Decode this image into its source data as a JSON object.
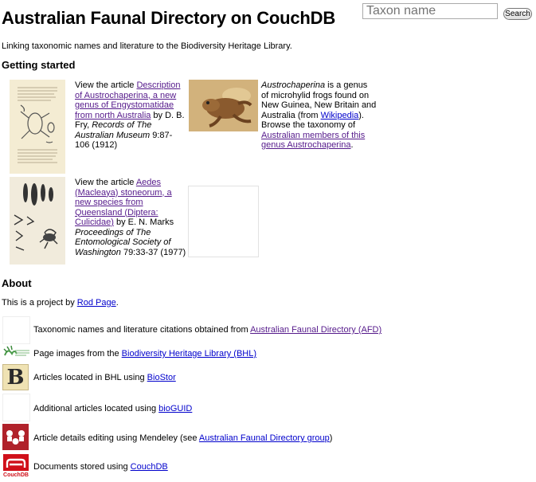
{
  "header": {
    "title": "Australian Faunal Directory on CouchDB",
    "search_placeholder": "Taxon name",
    "search_button": "Search",
    "subtitle": "Linking taxonomic names and literature to the Biodiversity Heritage Library."
  },
  "getting_started": {
    "heading": "Getting started",
    "article1": {
      "prefix": "View the article ",
      "link": "Description of Austrochaperina, a new genus of Engystomatidae from north Australia",
      "by": " by D. B. Fry, ",
      "journal": "Records of The Australian Museum",
      "citation": " 9:87-106 (1912)"
    },
    "taxon1": {
      "genus": "Austrochaperina",
      "desc": " is a genus of microhylid frogs found on New Guinea, New Britain and Australia (from ",
      "wiki_link": "Wikipedia",
      "desc2": "). Browse the taxonomy of ",
      "browse_link": "Australian members of this genus Austrochaperina",
      "end": "."
    },
    "article2": {
      "prefix": "View the article ",
      "link": "Aedes (Macleaya) stoneorum, a new species from Queensland (Diptera: Culicidae)",
      "by": " by E. N. Marks ",
      "journal": "Proceedings of The Entomological Society of Washington",
      "citation": " 79:33-37 (1977)"
    }
  },
  "about": {
    "heading": "About",
    "intro_prefix": "This is a project by ",
    "author_link": "Rod Page",
    "intro_end": ".",
    "rows": [
      {
        "text": "Taxonomic names and literature citations obtained from ",
        "link": "Australian Faunal Directory (AFD)",
        "after": "",
        "icon": "afd-icon"
      },
      {
        "text": "Page images from the ",
        "link": "Biodiversity Heritage Library (BHL)",
        "after": "",
        "icon": "bhl-logo-icon"
      },
      {
        "text": "Articles located in BHL using ",
        "link": "BioStor",
        "after": "",
        "icon": "biostor-icon"
      },
      {
        "text": "Additional articles located using ",
        "link": "bioGUID",
        "after": "",
        "icon": "bioguid-icon"
      },
      {
        "text": "Article details editing using Mendeley (see ",
        "link": "Australian Faunal Directory group",
        "after": ")",
        "icon": "mendeley-icon"
      },
      {
        "text": "Documents stored using ",
        "link": "CouchDB",
        "after": "",
        "icon": "couchdb-icon"
      }
    ],
    "biostor_letter": "B",
    "couchdb_label": "CouchDB"
  }
}
